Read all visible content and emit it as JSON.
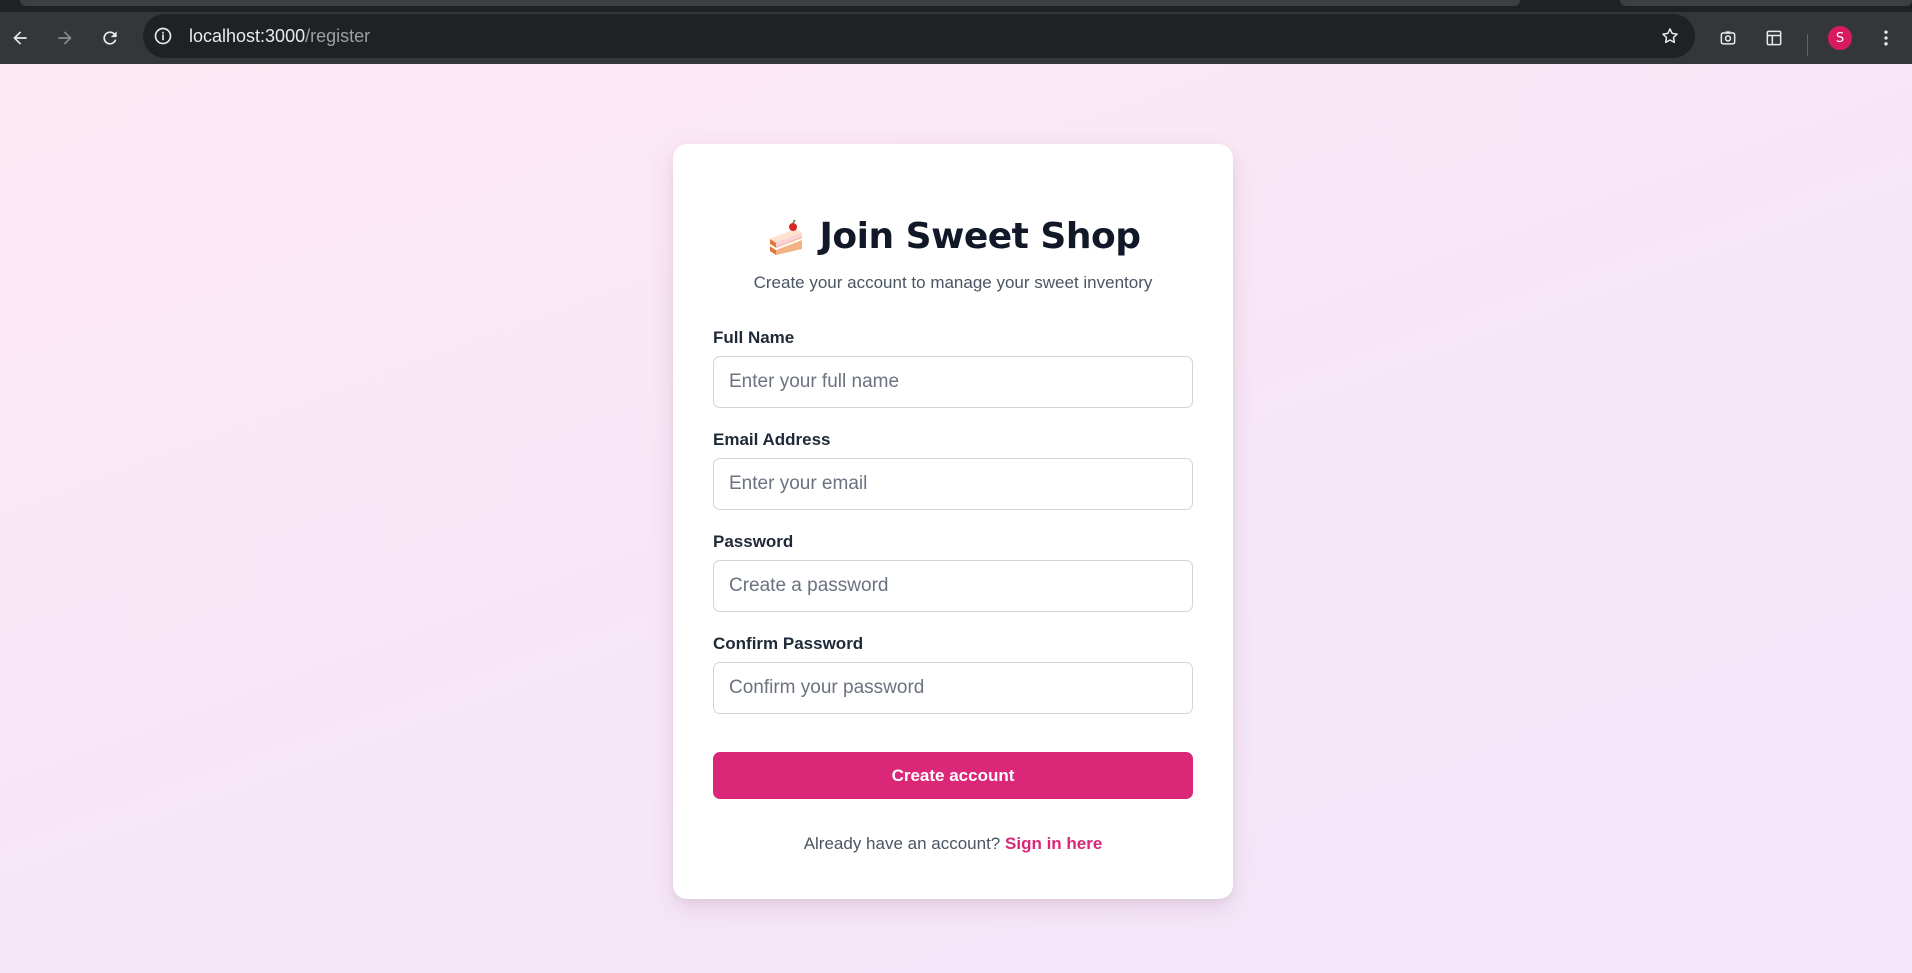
{
  "browser": {
    "url_host": "localhost:3000",
    "url_path": "/register",
    "profile_initial": "S",
    "icons": {
      "back": "arrow-left-icon",
      "forward": "arrow-right-icon",
      "reload": "reload-icon",
      "site_info": "info-icon",
      "bookmark": "star-icon",
      "screenshot": "capture-icon",
      "side_panel": "side-panel-icon",
      "menu": "kebab-menu-icon"
    },
    "colors": {
      "toolbar": "#35363a",
      "omnibox": "#202124",
      "avatar": "#d81b60"
    }
  },
  "register": {
    "title": "Join Sweet Shop",
    "title_icon": "cake-slice-icon",
    "subtitle": "Create your account to manage your sweet inventory",
    "fields": [
      {
        "label": "Full Name",
        "placeholder": "Enter your full name",
        "value": ""
      },
      {
        "label": "Email Address",
        "placeholder": "Enter your email",
        "value": ""
      },
      {
        "label": "Password",
        "placeholder": "Create a password",
        "value": ""
      },
      {
        "label": "Confirm Password",
        "placeholder": "Confirm your password",
        "value": ""
      }
    ],
    "submit_label": "Create account",
    "footer_text": "Already have an account?",
    "footer_link": "Sign in here",
    "colors": {
      "accent": "#db2777",
      "background": "#fbe7f3",
      "card": "#ffffff"
    }
  }
}
